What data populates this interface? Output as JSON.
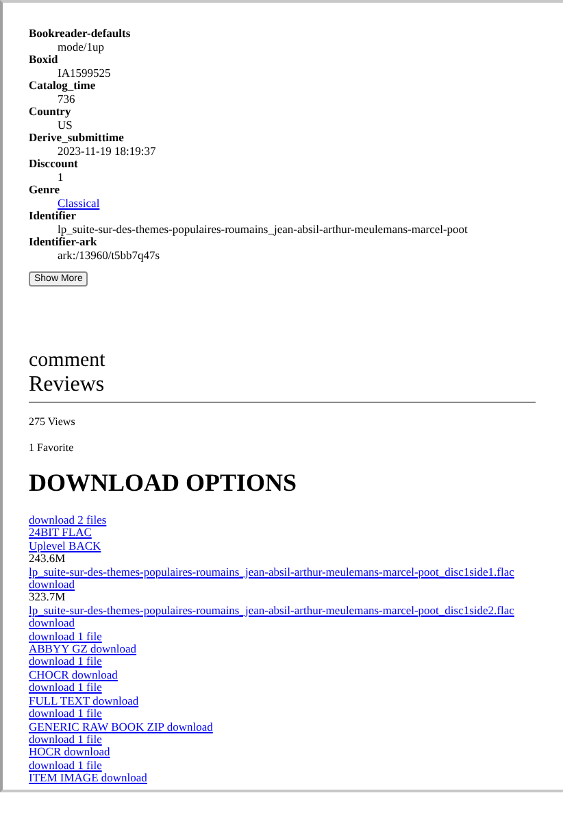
{
  "metadata": [
    {
      "label": "Bookreader-defaults",
      "value": "mode/1up",
      "kind": "text"
    },
    {
      "label": "Boxid",
      "value": "IA1599525",
      "kind": "text"
    },
    {
      "label": "Catalog_time",
      "value": "736",
      "kind": "text"
    },
    {
      "label": "Country",
      "value": "US",
      "kind": "text"
    },
    {
      "label": "Derive_submittime",
      "value": "2023-11-19 18:19:37",
      "kind": "text"
    },
    {
      "label": "Disccount",
      "value": "1",
      "kind": "text"
    },
    {
      "label": "Genre",
      "value": "Classical",
      "kind": "link"
    },
    {
      "label": "Identifier",
      "value": "lp_suite-sur-des-themes-populaires-roumains_jean-absil-arthur-meulemans-marcel-poot",
      "kind": "text"
    },
    {
      "label": "Identifier-ark",
      "value": "ark:/13960/t5bb7q47s",
      "kind": "text"
    }
  ],
  "show_more_button": "Show More",
  "comment_heading": "comment",
  "reviews_heading": "Reviews",
  "views": "275 Views",
  "favorites": "1 Favorite",
  "download_heading": "DOWNLOAD OPTIONS",
  "downloads": [
    {
      "text": "download 2 files",
      "kind": "link"
    },
    {
      "text": "24BIT FLAC",
      "kind": "link"
    },
    {
      "text": "Uplevel BACK",
      "kind": "link"
    },
    {
      "text": "243.6M",
      "kind": "text"
    },
    {
      "text": "lp_suite-sur-des-themes-populaires-roumains_jean-absil-arthur-meulemans-marcel-poot_disc1side1.flac",
      "kind": "link"
    },
    {
      "text": "download",
      "kind": "link"
    },
    {
      "text": "323.7M",
      "kind": "text"
    },
    {
      "text": "lp_suite-sur-des-themes-populaires-roumains_jean-absil-arthur-meulemans-marcel-poot_disc1side2.flac",
      "kind": "link"
    },
    {
      "text": "download",
      "kind": "link"
    },
    {
      "text": "download 1 file",
      "kind": "link"
    },
    {
      "text": "ABBYY GZ download",
      "kind": "link"
    },
    {
      "text": "download 1 file",
      "kind": "link"
    },
    {
      "text": "CHOCR download",
      "kind": "link"
    },
    {
      "text": "download 1 file",
      "kind": "link"
    },
    {
      "text": "FULL TEXT download",
      "kind": "link"
    },
    {
      "text": "download 1 file",
      "kind": "link"
    },
    {
      "text": "GENERIC RAW BOOK ZIP download",
      "kind": "link"
    },
    {
      "text": "download 1 file",
      "kind": "link"
    },
    {
      "text": "HOCR download",
      "kind": "link"
    },
    {
      "text": "download 1 file",
      "kind": "link"
    },
    {
      "text": "ITEM IMAGE download",
      "kind": "link"
    }
  ]
}
